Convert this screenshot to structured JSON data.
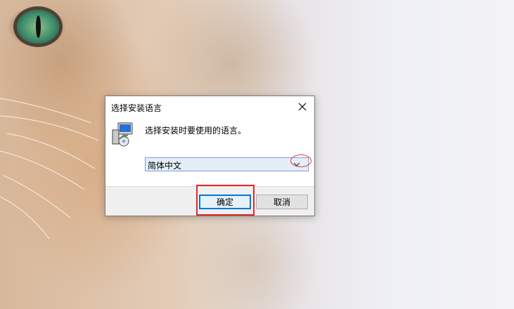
{
  "dialog": {
    "title": "选择安装语言",
    "prompt": "选择安装时要使用的语言。",
    "language_select": {
      "selected": "简体中文"
    },
    "ok_label": "确定",
    "cancel_label": "取消"
  },
  "icons": {
    "close": "close-icon",
    "installer": "installer-icon",
    "dropdown": "chevron-down-icon"
  },
  "colors": {
    "highlight": "#e02a2a",
    "accent": "#0078d7"
  }
}
